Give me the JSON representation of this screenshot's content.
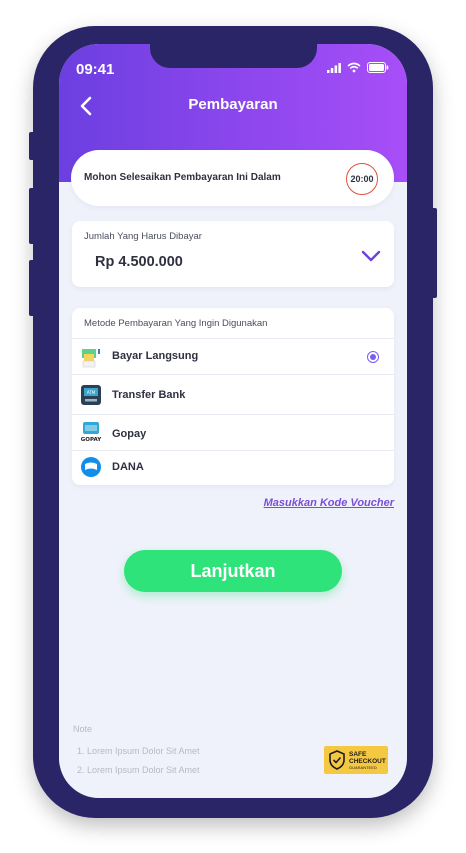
{
  "status": {
    "time": "09:41"
  },
  "header": {
    "title": "Pembayaran"
  },
  "timer": {
    "text": "Mohon Selesaikan Pembayaran Ini Dalam",
    "countdown": "20:00"
  },
  "amount": {
    "label": "Jumlah Yang Harus Dibayar",
    "value": "Rp 4.500.000"
  },
  "methods": {
    "label": "Metode Pembayaran Yang Ingin Digunakan",
    "items": [
      {
        "label": "Bayar Langsung",
        "icon": "cash-icon",
        "selected": true
      },
      {
        "label": "Transfer Bank",
        "icon": "atm-icon",
        "selected": false
      },
      {
        "label": "Gopay",
        "icon": "gopay-icon",
        "selected": false
      },
      {
        "label": "DANA",
        "icon": "dana-icon",
        "selected": false
      }
    ]
  },
  "voucher": {
    "label": "Masukkan Kode Voucher"
  },
  "cta": {
    "label": "Lanjutkan"
  },
  "note": {
    "title": "Note",
    "items": [
      "1. Lorem Ipsum Dolor Sit Amet",
      "2. Lorem Ipsum Dolor Sit Amet"
    ]
  },
  "badge": {
    "line1": "SAFE",
    "line2": "CHECKOUT",
    "line3": "GUARANTEED"
  },
  "colors": {
    "accent": "#7b4fd6",
    "cta": "#2ee37a",
    "frame": "#2a2566",
    "timer_ring": "#e2513e"
  }
}
